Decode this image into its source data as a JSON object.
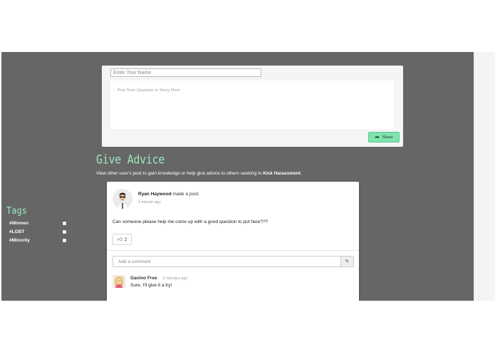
{
  "composer": {
    "name_placeholder": "Enter Your Name",
    "post_placeholder": "Post Your Question or Story Here",
    "share_label": "Share",
    "share_icon": "share-arrow-icon"
  },
  "give_advice": {
    "title": "Give Advice",
    "description_prefix": "View other user's post to gain knowledge or help give advice to others seeking to ",
    "description_emphasis": "Kick Harassment",
    "description_suffix": "."
  },
  "tags": {
    "title": "Tags",
    "items": [
      {
        "label": "#Women"
      },
      {
        "label": "#LGBT"
      },
      {
        "label": "#Minority"
      }
    ]
  },
  "post": {
    "author": "Ryan Haywood",
    "action": " made a post.",
    "time": "1 minute ago",
    "body": "Can someone please help me come up with a good question to put here???",
    "like_icon": "thumbs-up-icon",
    "like_count": "2",
    "comment_placeholder": "Add a comment",
    "comment_submit_icon": "edit-icon"
  },
  "comments": [
    {
      "author": "Gavino Free",
      "time": "5 minutes ago",
      "text": "Sure, I'll give it a try!"
    }
  ],
  "colors": {
    "background": "#666666",
    "accent": "#9de6bd",
    "share_button": "#7fe3ad",
    "card": "#ffffff"
  }
}
